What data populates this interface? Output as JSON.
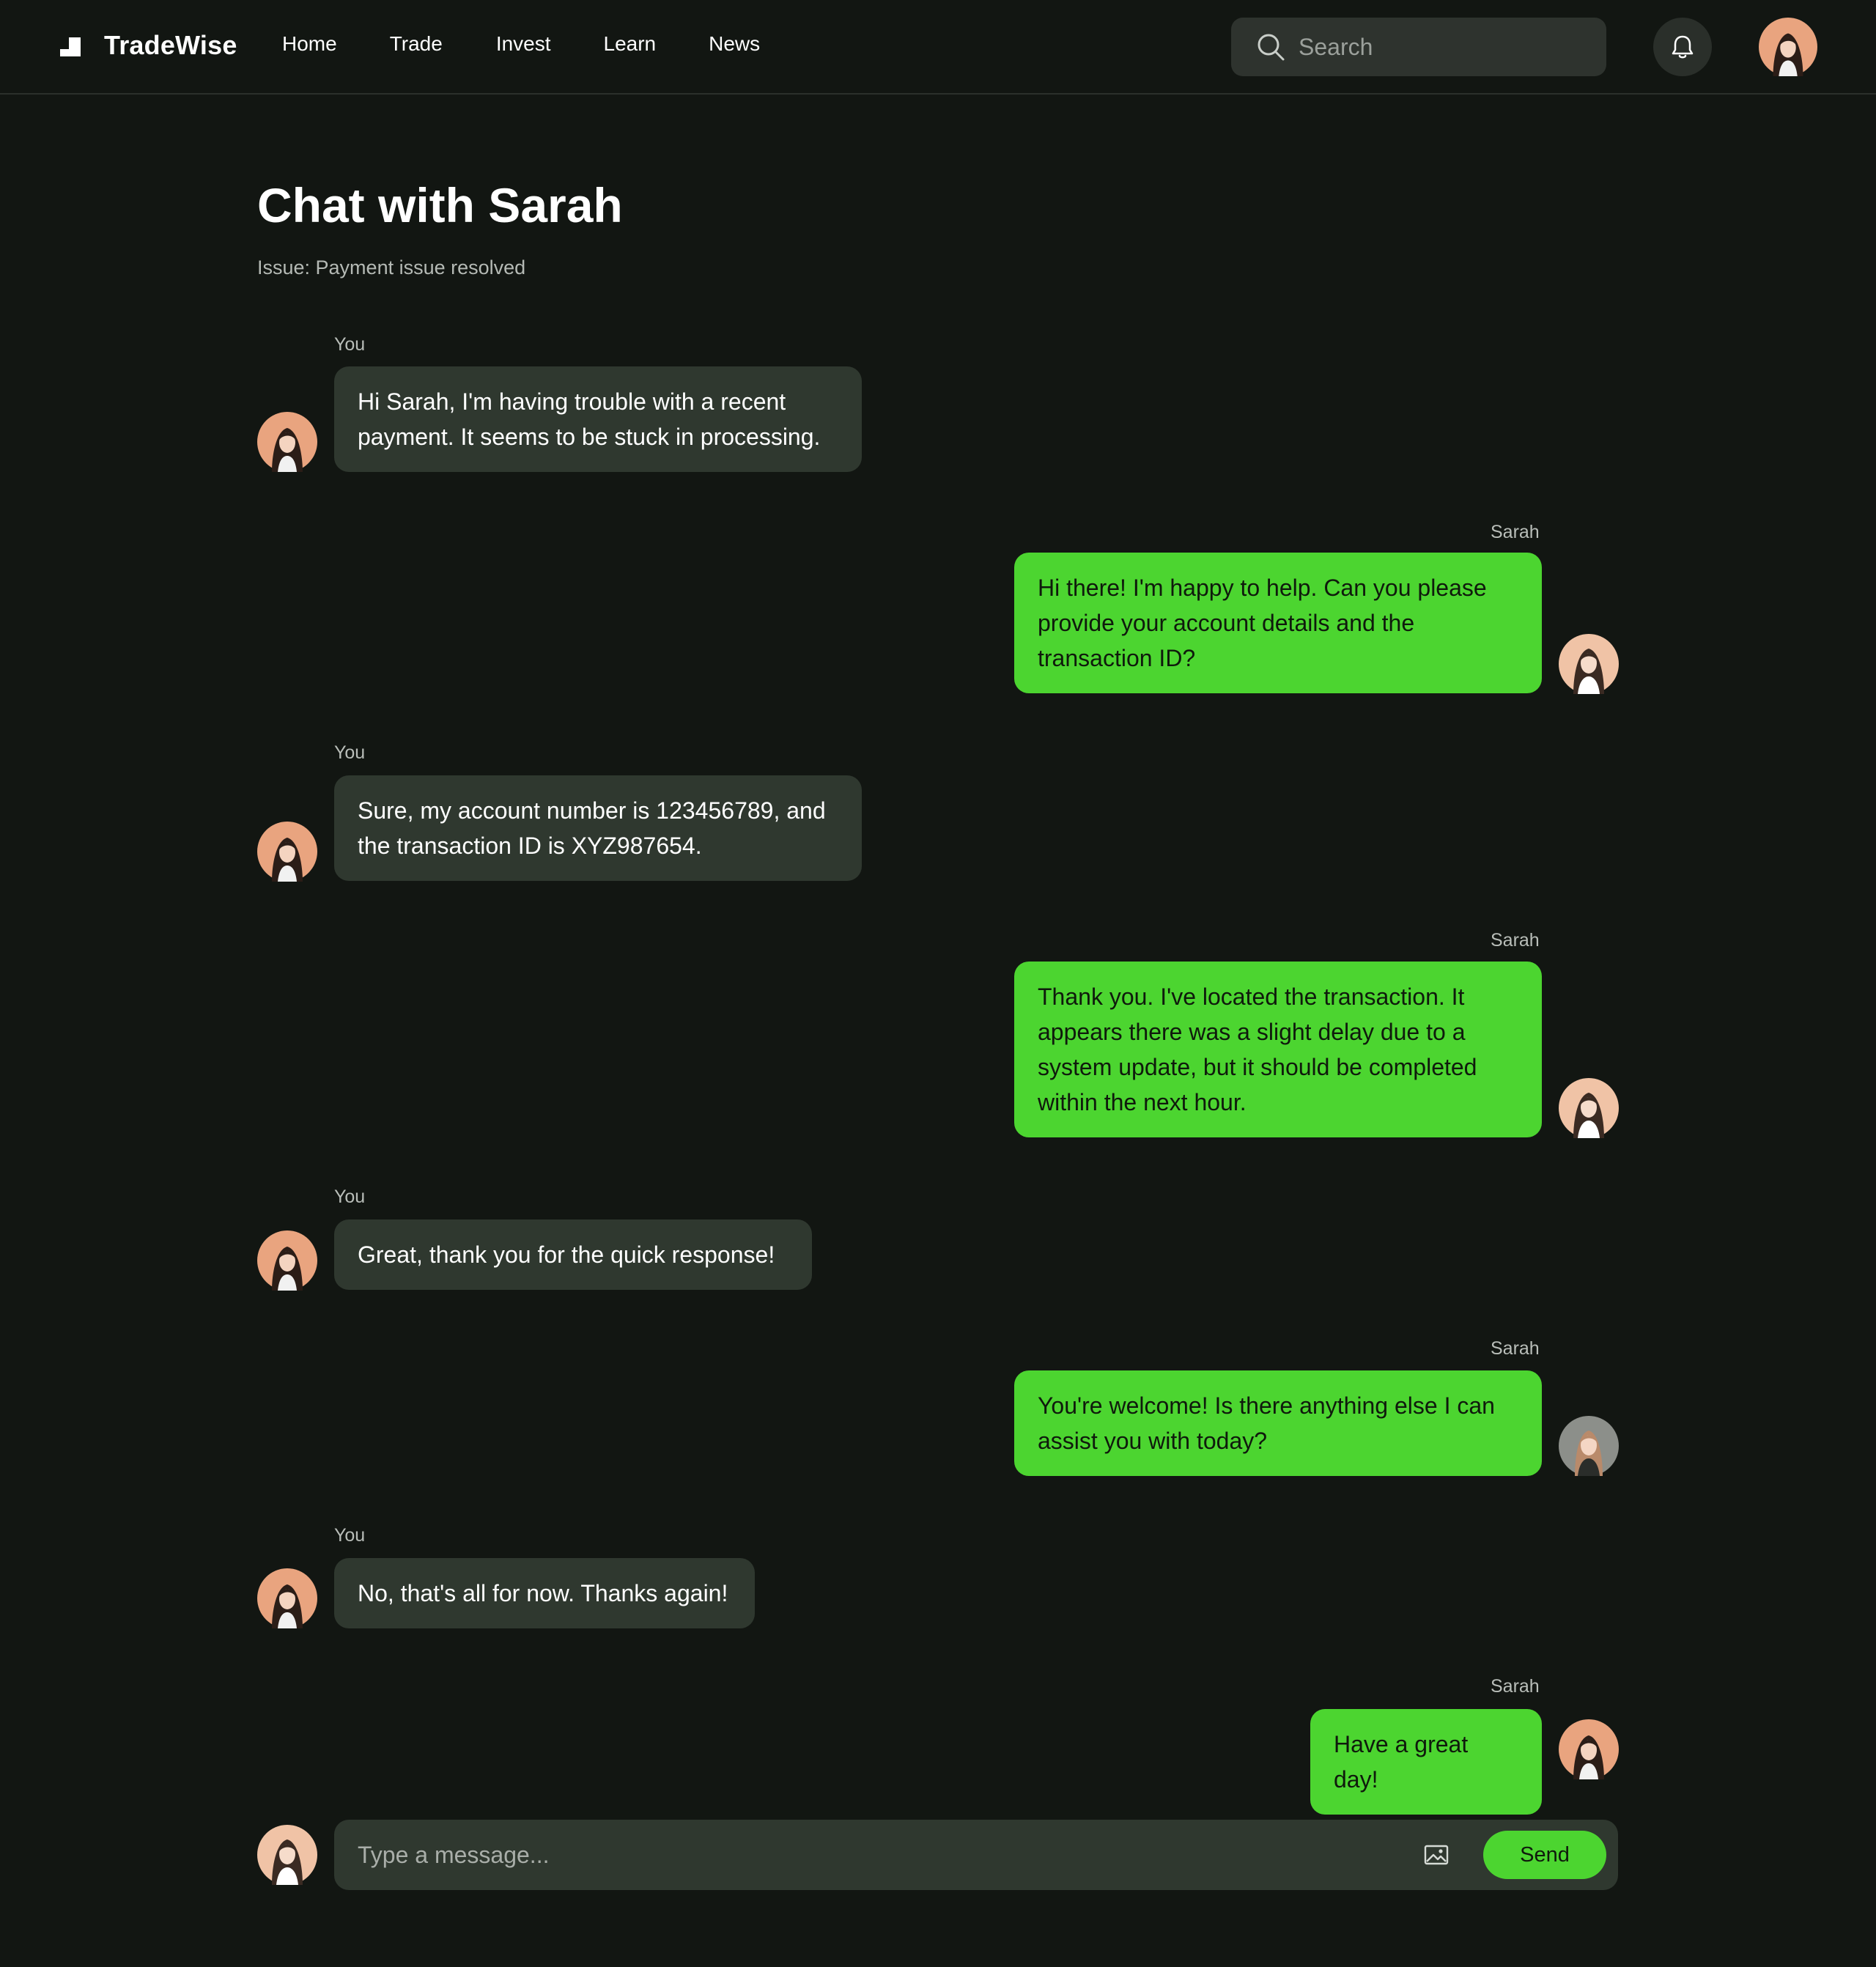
{
  "nav": {
    "brand": "TradeWise",
    "items": [
      "Home",
      "Trade",
      "Invest",
      "Learn",
      "News"
    ],
    "search_placeholder": "Search",
    "icons": [
      "logo-icon",
      "search-icon",
      "bell-icon",
      "user-avatar"
    ]
  },
  "chat": {
    "title": "Chat with Sarah",
    "subtitle": "Issue: Payment issue resolved",
    "messages": [
      {
        "sender": "You",
        "text": "Hi Sarah, I'm having trouble with a recent payment. It seems to be stuck in processing."
      },
      {
        "sender": "Sarah",
        "text": "Hi there! I'm happy to help. Can you please provide your account details and the transaction ID?"
      },
      {
        "sender": "You",
        "text": "Sure, my account number is 123456789, and the transaction ID is XYZ987654."
      },
      {
        "sender": "Sarah",
        "text": "Thank you. I've located the transaction. It appears there was a slight delay due to a system update, but it should be completed within the next hour."
      },
      {
        "sender": "You",
        "text": "Great, thank you for the quick response!"
      },
      {
        "sender": "Sarah",
        "text": "You're welcome! Is there anything else I can assist you with today?"
      },
      {
        "sender": "You",
        "text": "No, that's all for now. Thanks again!"
      },
      {
        "sender": "Sarah",
        "text": "Have a great day!"
      }
    ]
  },
  "composer": {
    "placeholder": "Type a message...",
    "send_label": "Send"
  },
  "colors": {
    "background": "#121612",
    "accent": "#4cd530",
    "bubble_user": "#2f382f",
    "search_bg": "#2e332e"
  }
}
